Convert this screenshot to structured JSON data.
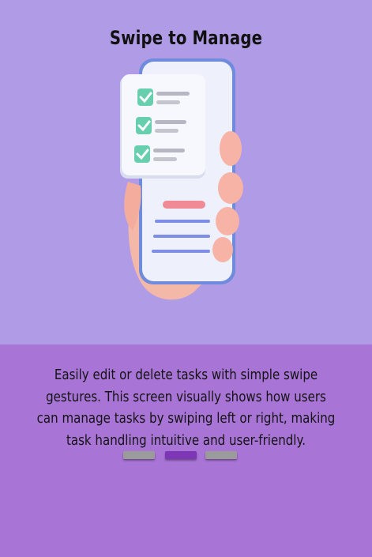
{
  "onboarding": {
    "title": "Swipe to Manage",
    "description": "Easily edit or delete tasks with simple swipe gestures. This screen visually shows how users can manage tasks by swiping left or right, making task handling intuitive and user-friendly.",
    "illustration_icon": "hand-holding-phone-with-checklist-icon",
    "pagination": {
      "total": 3,
      "active_index": 1,
      "active_color": "#7d37b6",
      "inactive_color": "#9b9b9b"
    }
  },
  "colors": {
    "top_background": "#b09be6",
    "bottom_background": "#a874d6"
  }
}
